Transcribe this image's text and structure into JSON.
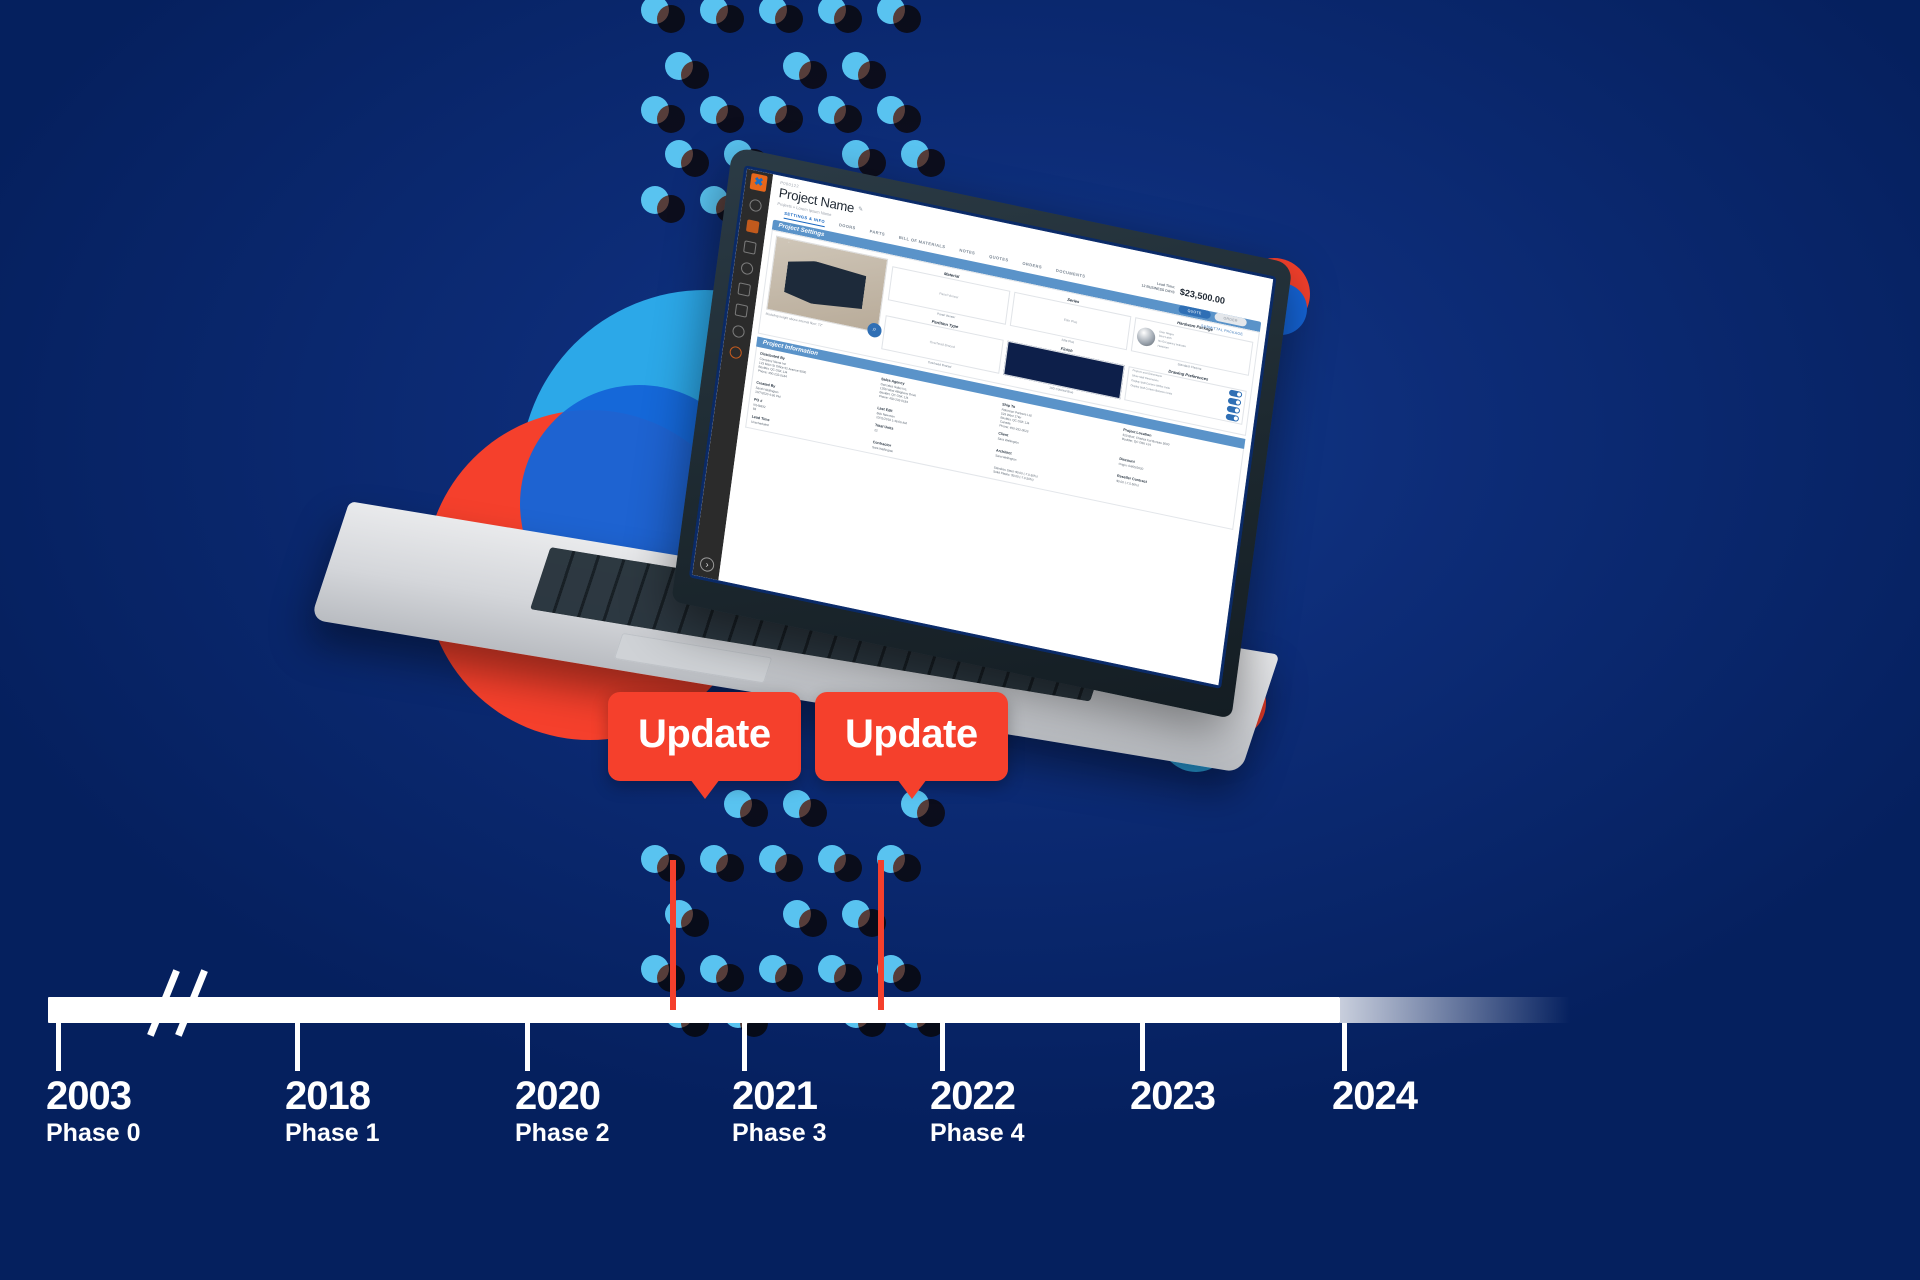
{
  "palette": {
    "background_navy": "#05205e",
    "mid_blue": "#113a8c",
    "accent_red": "#F5402C",
    "accent_sky": "#59C3F0",
    "accent_blue": "#1565D8",
    "timeline_bar": "#FFFFFF"
  },
  "timeline": {
    "milestones": [
      {
        "year": "2003",
        "phase": "Phase 0"
      },
      {
        "year": "2018",
        "phase": "Phase 1"
      },
      {
        "year": "2020",
        "phase": "Phase 2"
      },
      {
        "year": "2021",
        "phase": "Phase 3"
      },
      {
        "year": "2022",
        "phase": "Phase 4"
      },
      {
        "year": "2023",
        "phase": ""
      },
      {
        "year": "2024",
        "phase": ""
      }
    ],
    "callouts": [
      {
        "label": "Update"
      },
      {
        "label": "Update"
      }
    ]
  },
  "app": {
    "project_id": "P000122",
    "project_name": "Project Name",
    "breadcrumb": "Projects  »  Lorem Ipsum Name",
    "tabs": [
      {
        "label": "SETTINGS & INFO",
        "active": true
      },
      {
        "label": "DOORS",
        "active": false
      },
      {
        "label": "PARTS",
        "active": false
      },
      {
        "label": "BILL OF MATERIALS",
        "active": false
      },
      {
        "label": "NOTES",
        "active": false
      },
      {
        "label": "QUOTES",
        "active": false
      },
      {
        "label": "ORDERS",
        "active": false
      },
      {
        "label": "DOCUMENTS",
        "active": false
      }
    ],
    "price": {
      "label_line1": "Lead Time:",
      "label_line2": "12 BUSINESS DAYS",
      "amount": "$23,500.00"
    },
    "buttons": [
      {
        "label": "QUOTE",
        "style": "primary"
      },
      {
        "label": "ORDER",
        "style": "ghost"
      }
    ],
    "submittal_link": "SUBMITTAL PACKAGE",
    "sections": {
      "settings_title": "Project Settings",
      "information_title": "Project Information"
    },
    "settings": {
      "photo_caption": "Modeling height above internal floor: 72\"",
      "fields": [
        {
          "title": "Material",
          "value": "Panel Veneer",
          "caption": "Panel Veneer"
        },
        {
          "title": "Series",
          "value": "Elite Plus",
          "caption": "Elite Plus"
        },
        {
          "title": "Hardware Package",
          "value": "Standard Chrome",
          "caption": "Standard Chrome"
        },
        {
          "title": "Partition Type",
          "value": "Overhead Braced",
          "caption": "Overhead Braced"
        },
        {
          "title": "Finish",
          "value": "10D Colonial Blue",
          "caption": "10D Colonial Blue"
        },
        {
          "title": "Drawing Preferences",
          "value": "",
          "caption": ""
        }
      ],
      "hardware_sublabels": [
        "Door Hinges",
        "Door Latch",
        "No Occupancy Indicator",
        "Hardware"
      ],
      "drawing_preferences": [
        "Project Level Dimensions",
        "Show Stall Dimensions",
        "Display Stall Centers Within Units",
        "Display Stall Centers Between Units"
      ]
    },
    "information": {
      "columns": [
        {
          "heading": "Distributed By",
          "lines": [
            "Company Name Inc",
            "123 Main St Office 52 Avenue 5000",
            "Boulder, QC G5K 1J4",
            "Phone: 450-232-0184"
          ]
        },
        {
          "heading": "Sales Agency",
          "lines": [
            "Gonzales Sales Inc.",
            "1256 West Allegheny Drive",
            "Boulder, QC G5K 1J4",
            "Phone: 450-232-0184"
          ]
        },
        {
          "heading": "Ship To",
          "lines": [
            "Robinson Partners Ltd.",
            "523 West 17ter",
            "Boulder, QC G5K 1J4",
            "Canada",
            "Phone: 450-232-0023"
          ]
        },
        {
          "heading": "Project Location",
          "lines": [
            "520 Blvd. Charles Est Bureau 5000",
            "Boulder, QC G5K 1J4"
          ]
        },
        {
          "heading": "Created By",
          "lines": [
            "Sarah Wellington",
            "10/7/2020 4:36 PM"
          ]
        },
        {
          "heading": "Last Edit",
          "lines": [
            "Bob Newman",
            "10/11/2018 1:46:06 AM"
          ]
        },
        {
          "heading": "Client",
          "lines": [
            "Sara Wellington"
          ]
        },
        {
          "heading": "Discount",
          "lines": [
            "Origin: 04/05/2020"
          ]
        },
        {
          "heading": "PO #",
          "lines": [
            "N148392",
            "83"
          ]
        },
        {
          "heading": "Total Units",
          "lines": [
            "22"
          ]
        },
        {
          "heading": "Architect",
          "lines": [
            "Sara Wellington"
          ]
        },
        {
          "heading": "Reseller Contract",
          "lines": [
            "$0.00 (-7.5.50%)"
          ]
        },
        {
          "heading": "Lead Time",
          "lines": [
            "Unscheduled"
          ]
        },
        {
          "heading": "Contractor",
          "lines": [
            "Sara Wellington"
          ]
        },
        {
          "heading": "",
          "lines": [
            "Stainless Steel: $0.00 (-7.0.50%)",
            "Solid Plastic: $0.00 (-7.0.50%)"
          ]
        }
      ]
    }
  }
}
